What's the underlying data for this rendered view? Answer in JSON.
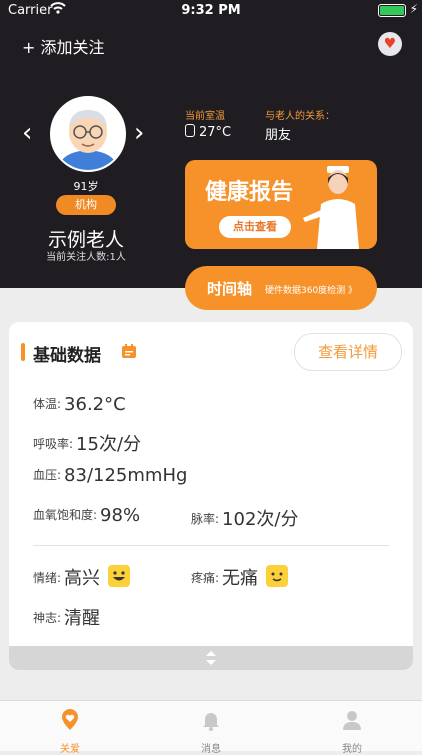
{
  "status": {
    "carrier": "Carrier",
    "time": "9:32 PM"
  },
  "header": {
    "add_label": "+ 添加关注"
  },
  "profile": {
    "age": "91岁",
    "tag": "机构",
    "name": "示例老人",
    "follow_count": "当前关注人数:1人"
  },
  "info": {
    "room_temp_label": "当前室温",
    "room_temp_value": "27°C",
    "relation_label": "与老人的关系：",
    "relation_value": "朋友"
  },
  "banner": {
    "title": "健康报告",
    "button": "点击查看"
  },
  "timeline": {
    "title": "时间轴",
    "subtitle": "硬件数据360度检测 》"
  },
  "basic": {
    "title": "基础数据",
    "detail_button": "查看详情",
    "temperature_label": "体温:",
    "temperature_value": "36.2°C",
    "respiration_label": "呼吸率:",
    "respiration_value": "15次/分",
    "blood_pressure_label": "血压:",
    "blood_pressure_value": "83/125mmHg",
    "spo2_label": "血氧饱和度:",
    "spo2_value": "98%",
    "pulse_label": "脉率:",
    "pulse_value": "102次/分",
    "mood_label": "情绪:",
    "mood_value": "高兴",
    "pain_label": "疼痛:",
    "pain_value": "无痛",
    "consciousness_label": "神志:",
    "consciousness_value": "清醒"
  },
  "tabs": [
    {
      "label": "关爱",
      "icon": "location-heart-icon"
    },
    {
      "label": "消息",
      "icon": "bell-icon"
    },
    {
      "label": "我的",
      "icon": "user-icon"
    }
  ],
  "colors": {
    "accent": "#f7922a",
    "header_bg": "#1f1d22",
    "tab_active": "#f7922a"
  }
}
